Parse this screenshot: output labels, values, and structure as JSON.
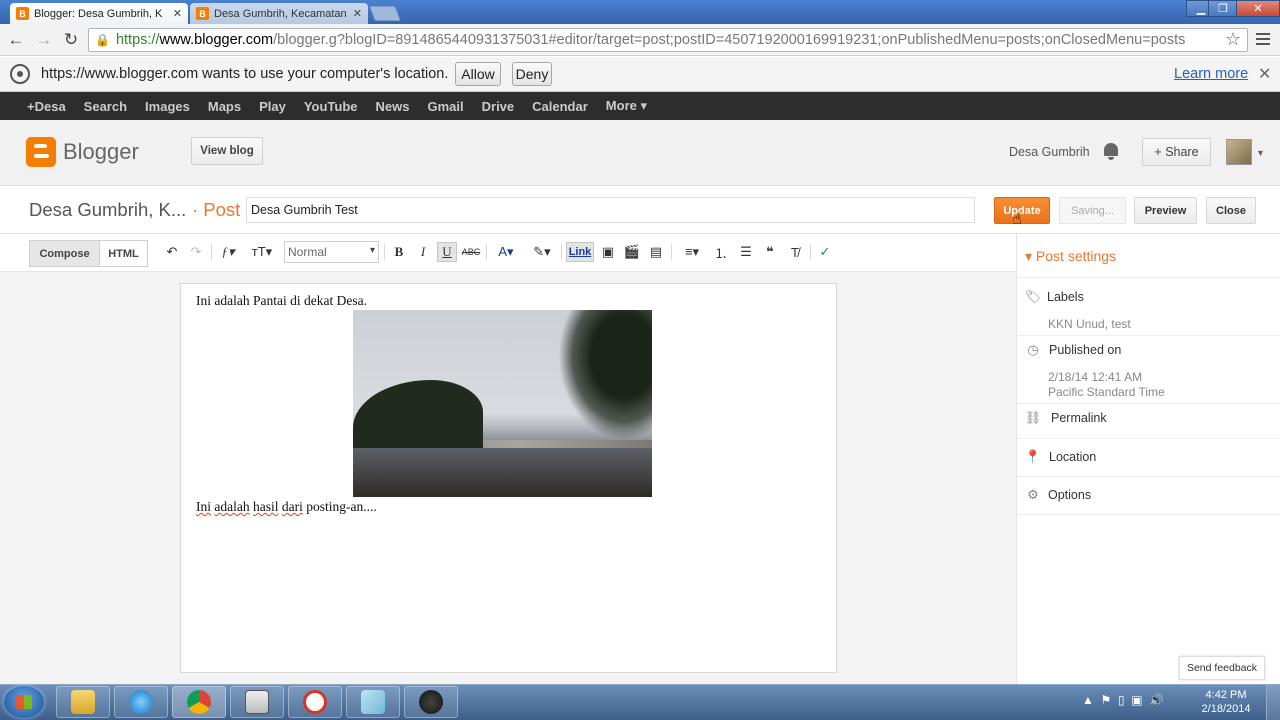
{
  "browser": {
    "tabs": [
      {
        "label": "Blogger: Desa Gumbrih, K",
        "active": true
      },
      {
        "label": "Desa Gumbrih, Kecamatan",
        "active": false
      }
    ],
    "url": {
      "scheme": "https://",
      "host": "www.blogger.com",
      "path": "/blogger.g?blogID=8914865440931375031#editor/target=post;postID=4507192000169919231;onPublishedMenu=posts;onClosedMenu=posts"
    }
  },
  "infobar": {
    "message": "https://www.blogger.com wants to use your computer's location.",
    "allow_label": "Allow",
    "deny_label": "Deny",
    "learn_more_label": "Learn more"
  },
  "google_bar": {
    "items": [
      "+Desa",
      "Search",
      "Images",
      "Maps",
      "Play",
      "YouTube",
      "News",
      "Gmail",
      "Drive",
      "Calendar",
      "More ▾"
    ]
  },
  "header": {
    "brand": "Blogger",
    "view_blog_label": "View blog",
    "user_name": "Desa Gumbrih",
    "share_label": "+ Share"
  },
  "post": {
    "blog_title": "Desa Gumbrih, K...",
    "section": "· Post",
    "title_value": "Desa Gumbrih Test",
    "update_label": "Update",
    "saving_label": "Saving...",
    "preview_label": "Preview",
    "close_label": "Close"
  },
  "editor_toolbar": {
    "compose_label": "Compose",
    "html_label": "HTML",
    "font_size": "Normal",
    "link_label": "Link"
  },
  "content": {
    "paragraph1": "Ini adalah Pantai di dekat Desa.",
    "paragraph2_words": [
      "Ini",
      "adalah",
      "hasil",
      "dari",
      "posting-an...."
    ]
  },
  "settings": {
    "heading": "Post settings",
    "labels_label": "Labels",
    "labels_value": "KKN Unud, test",
    "published_label": "Published on",
    "published_date": "2/18/14 12:41 AM",
    "published_tz": "Pacific Standard Time",
    "permalink_label": "Permalink",
    "location_label": "Location",
    "options_label": "Options",
    "feedback_label": "Send feedback"
  },
  "taskbar": {
    "time": "4:42 PM",
    "date": "2/18/2014"
  },
  "colors": {
    "accent": "#e8782d",
    "brand": "#f57d00",
    "gbar": "#2d2d2d"
  }
}
